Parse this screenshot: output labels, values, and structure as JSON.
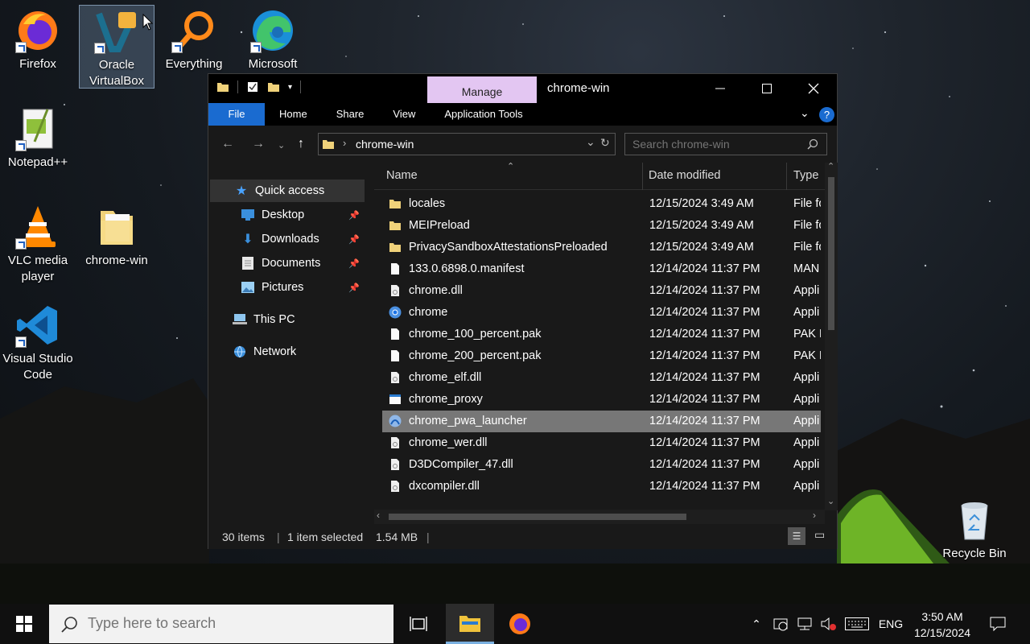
{
  "desktop": {
    "icons": [
      {
        "label": "Firefox",
        "icon": "firefox-icon"
      },
      {
        "label": "Oracle VirtualBox",
        "icon": "virtualbox-icon"
      },
      {
        "label": "Everything",
        "icon": "everything-search-icon"
      },
      {
        "label": "Microsoft",
        "icon": "edge-icon"
      },
      {
        "label": "Notepad++",
        "icon": "notepadpp-icon"
      },
      {
        "label": "VLC media player",
        "icon": "vlc-icon"
      },
      {
        "label": "chrome-win",
        "icon": "folder-icon"
      },
      {
        "label": "Visual Studio Code",
        "icon": "vscode-icon"
      },
      {
        "label": "Recycle Bin",
        "icon": "recycle-bin-icon"
      }
    ]
  },
  "window": {
    "title": "chrome-win",
    "manage_tab": "Manage",
    "ribbon_tabs": [
      "File",
      "Home",
      "Share",
      "View",
      "Application Tools"
    ],
    "address": "chrome-win",
    "search_placeholder": "Search chrome-win",
    "nav": {
      "quick_access": "Quick access",
      "desktop": "Desktop",
      "downloads": "Downloads",
      "documents": "Documents",
      "pictures": "Pictures",
      "this_pc": "This PC",
      "network": "Network"
    },
    "columns": {
      "name": "Name",
      "date": "Date modified",
      "type": "Type"
    },
    "files": [
      {
        "name": "locales",
        "date": "12/15/2024 3:49 AM",
        "type": "File fo",
        "icon": "folder-icon"
      },
      {
        "name": "MEIPreload",
        "date": "12/15/2024 3:49 AM",
        "type": "File fo",
        "icon": "folder-icon"
      },
      {
        "name": "PrivacySandboxAttestationsPreloaded",
        "date": "12/15/2024 3:49 AM",
        "type": "File fo",
        "icon": "folder-icon"
      },
      {
        "name": "133.0.6898.0.manifest",
        "date": "12/14/2024 11:37 PM",
        "type": "MAN",
        "icon": "file-icon"
      },
      {
        "name": "chrome.dll",
        "date": "12/14/2024 11:37 PM",
        "type": "Appli",
        "icon": "dll-icon"
      },
      {
        "name": "chrome",
        "date": "12/14/2024 11:37 PM",
        "type": "Appli",
        "icon": "chrome-icon"
      },
      {
        "name": "chrome_100_percent.pak",
        "date": "12/14/2024 11:37 PM",
        "type": "PAK F",
        "icon": "file-icon"
      },
      {
        "name": "chrome_200_percent.pak",
        "date": "12/14/2024 11:37 PM",
        "type": "PAK F",
        "icon": "file-icon"
      },
      {
        "name": "chrome_elf.dll",
        "date": "12/14/2024 11:37 PM",
        "type": "Appli",
        "icon": "dll-icon"
      },
      {
        "name": "chrome_proxy",
        "date": "12/14/2024 11:37 PM",
        "type": "Appli",
        "icon": "exe-icon"
      },
      {
        "name": "chrome_pwa_launcher",
        "date": "12/14/2024 11:37 PM",
        "type": "Appli",
        "icon": "pwa-icon",
        "selected": true
      },
      {
        "name": "chrome_wer.dll",
        "date": "12/14/2024 11:37 PM",
        "type": "Appli",
        "icon": "dll-icon"
      },
      {
        "name": "D3DCompiler_47.dll",
        "date": "12/14/2024 11:37 PM",
        "type": "Appli",
        "icon": "dll-icon"
      },
      {
        "name": "dxcompiler.dll",
        "date": "12/14/2024 11:37 PM",
        "type": "Appli",
        "icon": "dll-icon"
      }
    ],
    "status": {
      "items": "30 items",
      "selected": "1 item selected",
      "size": "1.54 MB"
    }
  },
  "taskbar": {
    "search_placeholder": "Type here to search",
    "language": "ENG",
    "time": "3:50 AM",
    "date": "12/15/2024"
  },
  "colors": {
    "manage_tab": "#e3c6f2",
    "file_tab": "#1a6bd0",
    "selection": "#777777"
  }
}
